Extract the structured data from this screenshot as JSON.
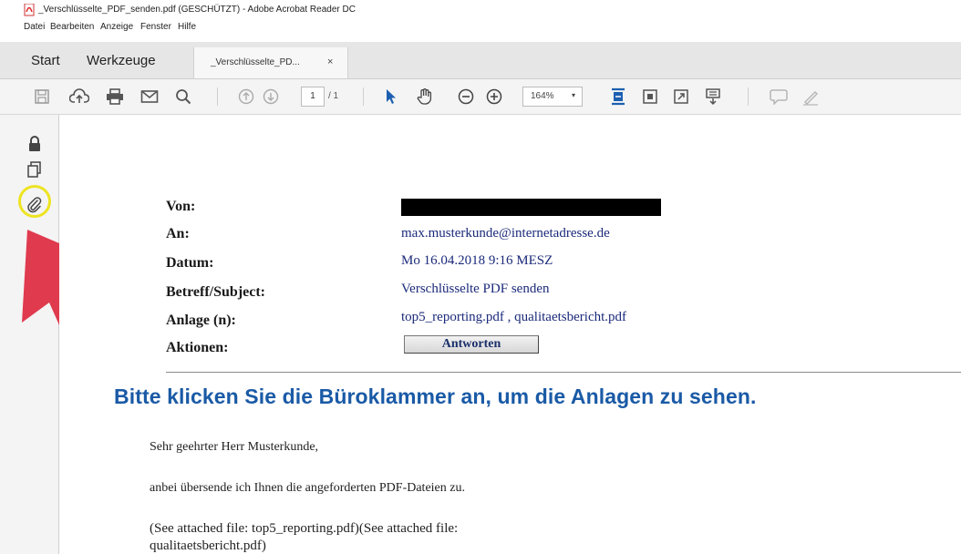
{
  "window": {
    "title": "_Verschlüsselte_PDF_senden.pdf (GESCHÜTZT) - Adobe Acrobat Reader DC"
  },
  "menu": [
    "Datei",
    "Bearbeiten",
    "Anzeige",
    "Fenster",
    "Hilfe"
  ],
  "tabs": {
    "start": "Start",
    "tools": "Werkzeuge",
    "document": "_Verschlüsselte_PD...",
    "close": "×"
  },
  "toolbar": {
    "icons": [
      "save-icon",
      "upload-cloud-icon",
      "print-icon",
      "email-icon",
      "search-icon",
      "page-up-icon",
      "page-down-icon",
      "select-pointer-icon",
      "hand-tool-icon",
      "zoom-out-icon",
      "zoom-in-icon",
      "fit-width-icon",
      "fit-page-icon",
      "fullscreen-icon",
      "scroll-mode-icon",
      "comment-icon",
      "sign-icon"
    ],
    "page_current": "1",
    "page_total": "/ 1",
    "zoom": "164%",
    "zoom_caret": "▾"
  },
  "leftnav": {
    "icons": [
      "lock-icon",
      "page-thumbnails-icon",
      "paperclip-attachments-icon"
    ]
  },
  "email": {
    "fields": [
      {
        "label": "Von:",
        "value": ""
      },
      {
        "label": "An:",
        "value": "max.musterkunde@internetadresse.de"
      },
      {
        "label": "Datum:",
        "value": "Mo 16.04.2018 9:16 MESZ"
      },
      {
        "label": "Betreff/Subject:",
        "value": "Verschlüsselte PDF senden"
      },
      {
        "label": "Anlage (n):",
        "value": "top5_reporting.pdf , qualitaetsbericht.pdf"
      },
      {
        "label": "Aktionen:",
        "value": ""
      }
    ],
    "reply_button": "Antworten",
    "hint": "Bitte klicken Sie die Büroklammer an,  um die Anlagen zu sehen.",
    "body": [
      "Sehr geehrter Herr Musterkunde,",
      "anbei übersende ich Ihnen die angeforderten PDF-Dateien zu.",
      "(See attached file: top5_reporting.pdf)(See attached file:",
      "qualitaetsbericht.pdf)"
    ]
  },
  "colors": {
    "highlight_circle": "#ede421",
    "arrow": "#e03a4e",
    "hint_text": "#1a5aa6",
    "link_text": "#1b2a7a"
  }
}
